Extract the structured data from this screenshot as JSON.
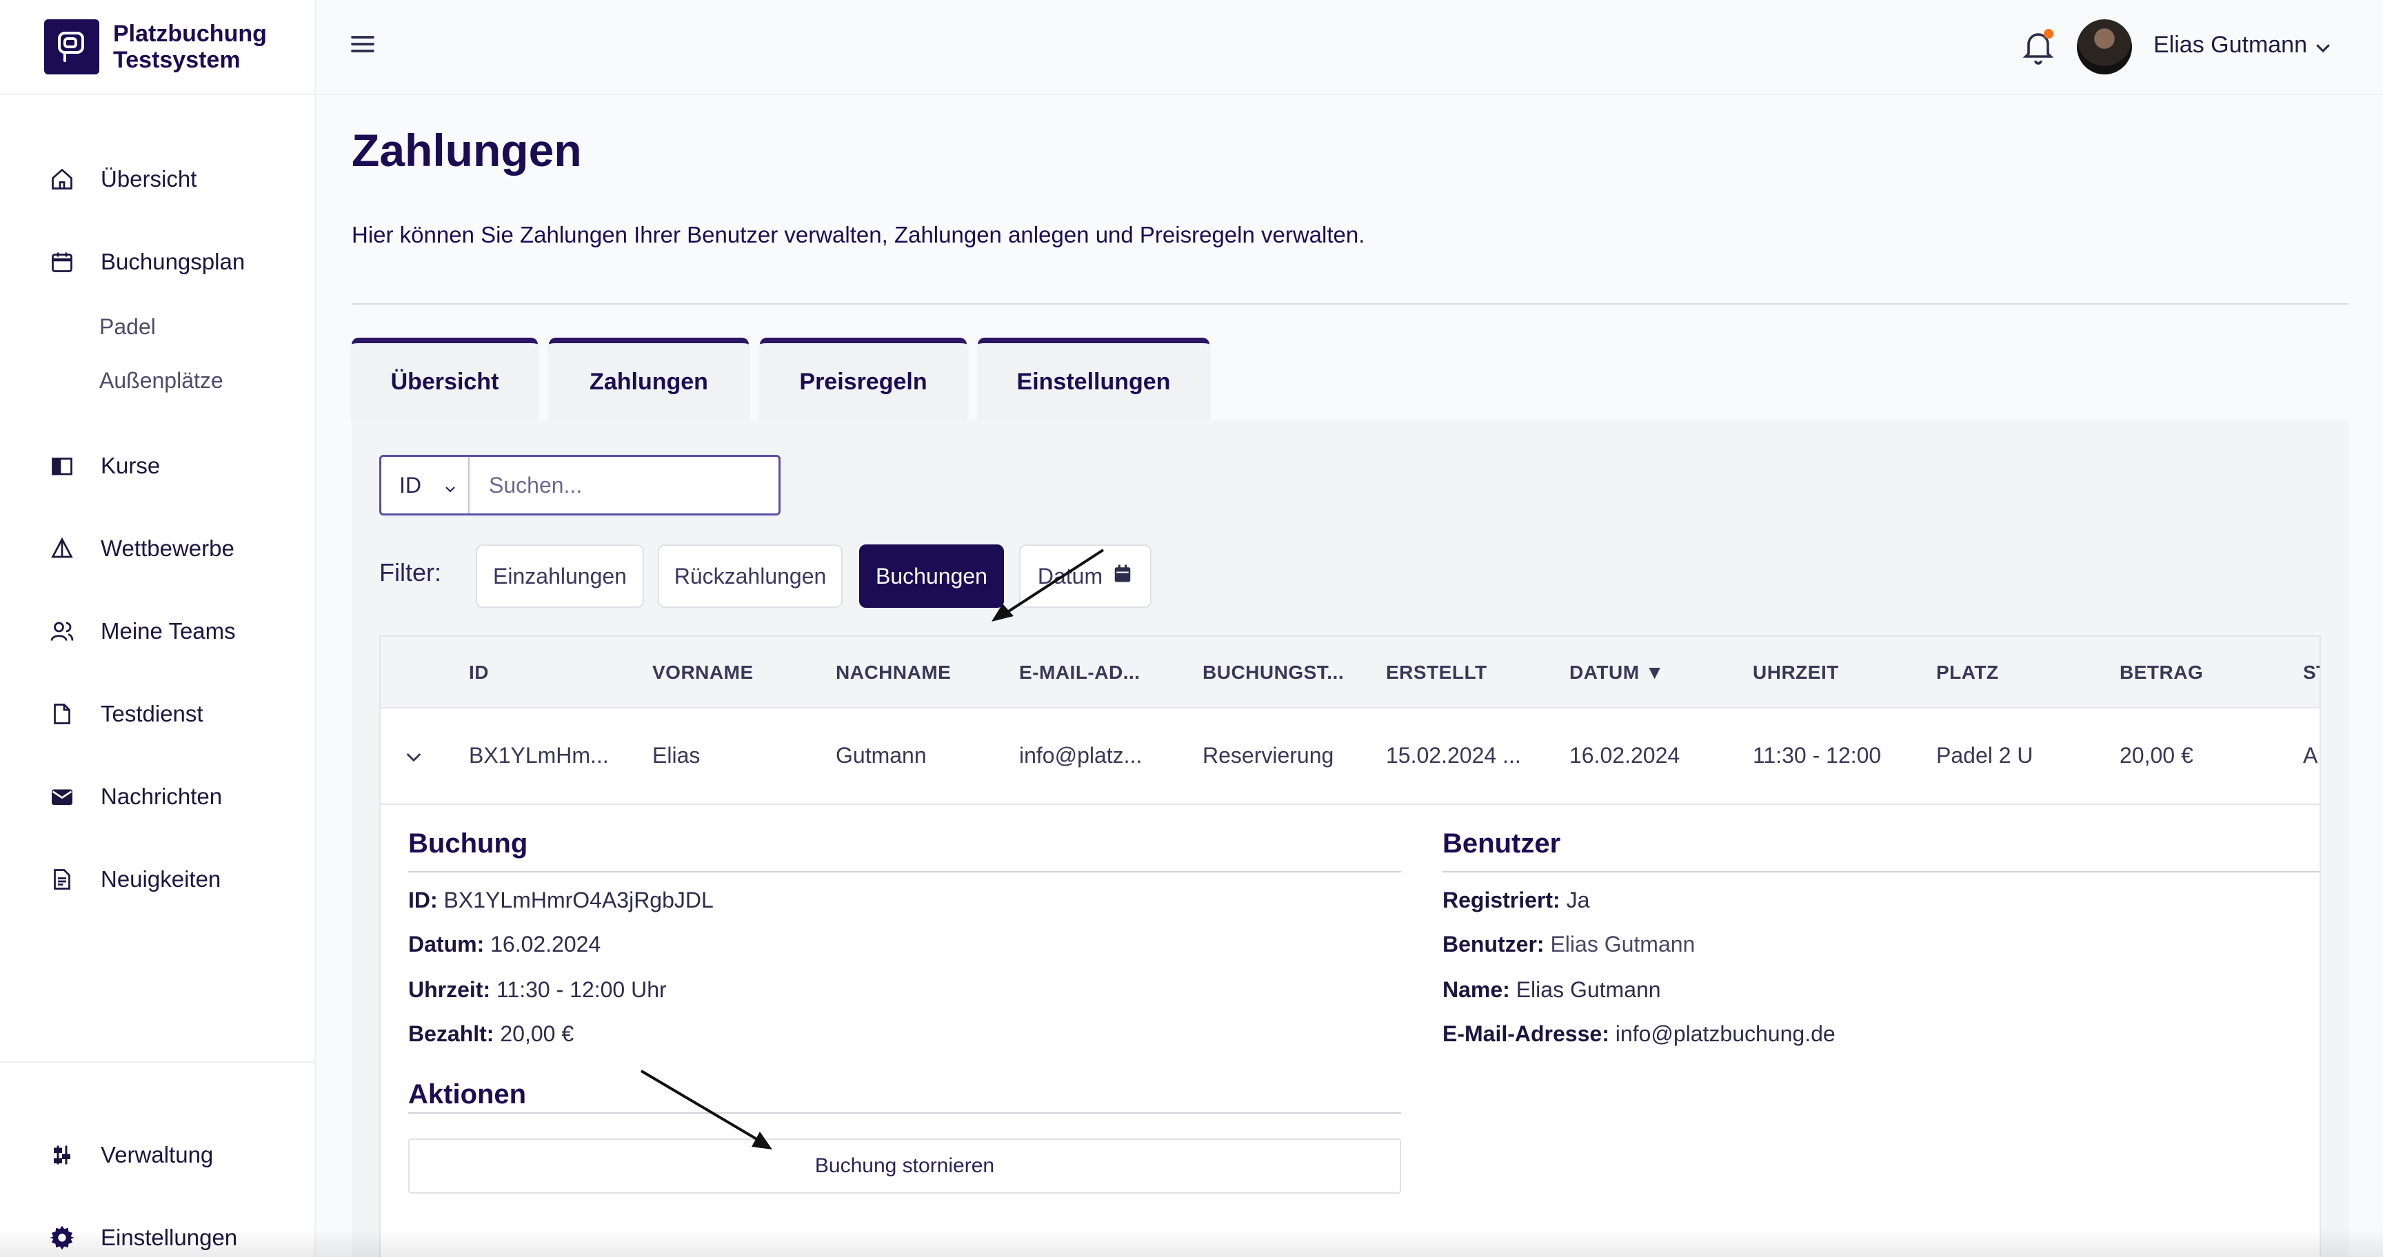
{
  "brand": {
    "line1": "Platzbuchung",
    "line2": "Testsystem"
  },
  "sidebar": {
    "items": [
      {
        "label": "Übersicht",
        "icon": "home-icon"
      },
      {
        "label": "Buchungsplan",
        "icon": "calendar-icon"
      },
      {
        "label": "Kurse",
        "icon": "book-icon"
      },
      {
        "label": "Wettbewerbe",
        "icon": "triangle-flag-icon"
      },
      {
        "label": "Meine Teams",
        "icon": "users-icon"
      },
      {
        "label": "Testdienst",
        "icon": "file-icon"
      },
      {
        "label": "Nachrichten",
        "icon": "envelope-icon"
      },
      {
        "label": "Neuigkeiten",
        "icon": "newspaper-icon"
      }
    ],
    "sub_items": [
      "Padel",
      "Außenplätze"
    ],
    "bottom_items": [
      {
        "label": "Verwaltung",
        "icon": "sliders-icon"
      },
      {
        "label": "Einstellungen",
        "icon": "gear-icon"
      }
    ]
  },
  "header": {
    "user_name": "Elias Gutmann"
  },
  "page": {
    "title": "Zahlungen",
    "description": "Hier können Sie Zahlungen Ihrer Benutzer verwalten, Zahlungen anlegen und Preisregeln verwalten."
  },
  "tabs": [
    "Übersicht",
    "Zahlungen",
    "Preisregeln",
    "Einstellungen"
  ],
  "search": {
    "field": "ID",
    "placeholder": "Suchen..."
  },
  "filter": {
    "label": "Filter:",
    "buttons": [
      "Einzahlungen",
      "Rückzahlungen",
      "Buchungen",
      "Datum"
    ],
    "active": "Buchungen"
  },
  "table": {
    "columns": [
      "ID",
      "VORNAME",
      "NACHNAME",
      "E-MAIL-AD...",
      "BUCHUNGST...",
      "ERSTELLT",
      "DATUM",
      "UHRZEIT",
      "PLATZ",
      "BETRAG",
      "ST"
    ],
    "sort_indicator": "▼",
    "row": {
      "id": "BX1YLmHm...",
      "vorname": "Elias",
      "nachname": "Gutmann",
      "email": "info@platz...",
      "buchungstyp": "Reservierung",
      "erstellt": "15.02.2024 ...",
      "datum": "16.02.2024",
      "uhrzeit": "11:30 - 12:00",
      "platz": "Padel 2 U",
      "betrag": "20,00 €",
      "status": "A"
    }
  },
  "detail": {
    "booking": {
      "title": "Buchung",
      "id_label": "ID:",
      "id_value": "BX1YLmHmrO4A3jRgbJDL",
      "datum_label": "Datum:",
      "datum_value": "16.02.2024",
      "uhrzeit_label": "Uhrzeit:",
      "uhrzeit_value": "11:30 - 12:00 Uhr",
      "bezahlt_label": "Bezahlt:",
      "bezahlt_value": "20,00 €"
    },
    "user": {
      "title": "Benutzer",
      "registriert_label": "Registriert:",
      "registriert_value": "Ja",
      "benutzer_label": "Benutzer:",
      "benutzer_value": "Elias Gutmann",
      "name_label": "Name:",
      "name_value": "Elias Gutmann",
      "email_label": "E-Mail-Adresse:",
      "email_value": "info@platzbuchung.de"
    },
    "actions": {
      "title": "Aktionen",
      "cancel_label": "Buchung stornieren"
    }
  },
  "colors": {
    "primary": "#1b0c54",
    "accent_dot": "#f97316"
  }
}
